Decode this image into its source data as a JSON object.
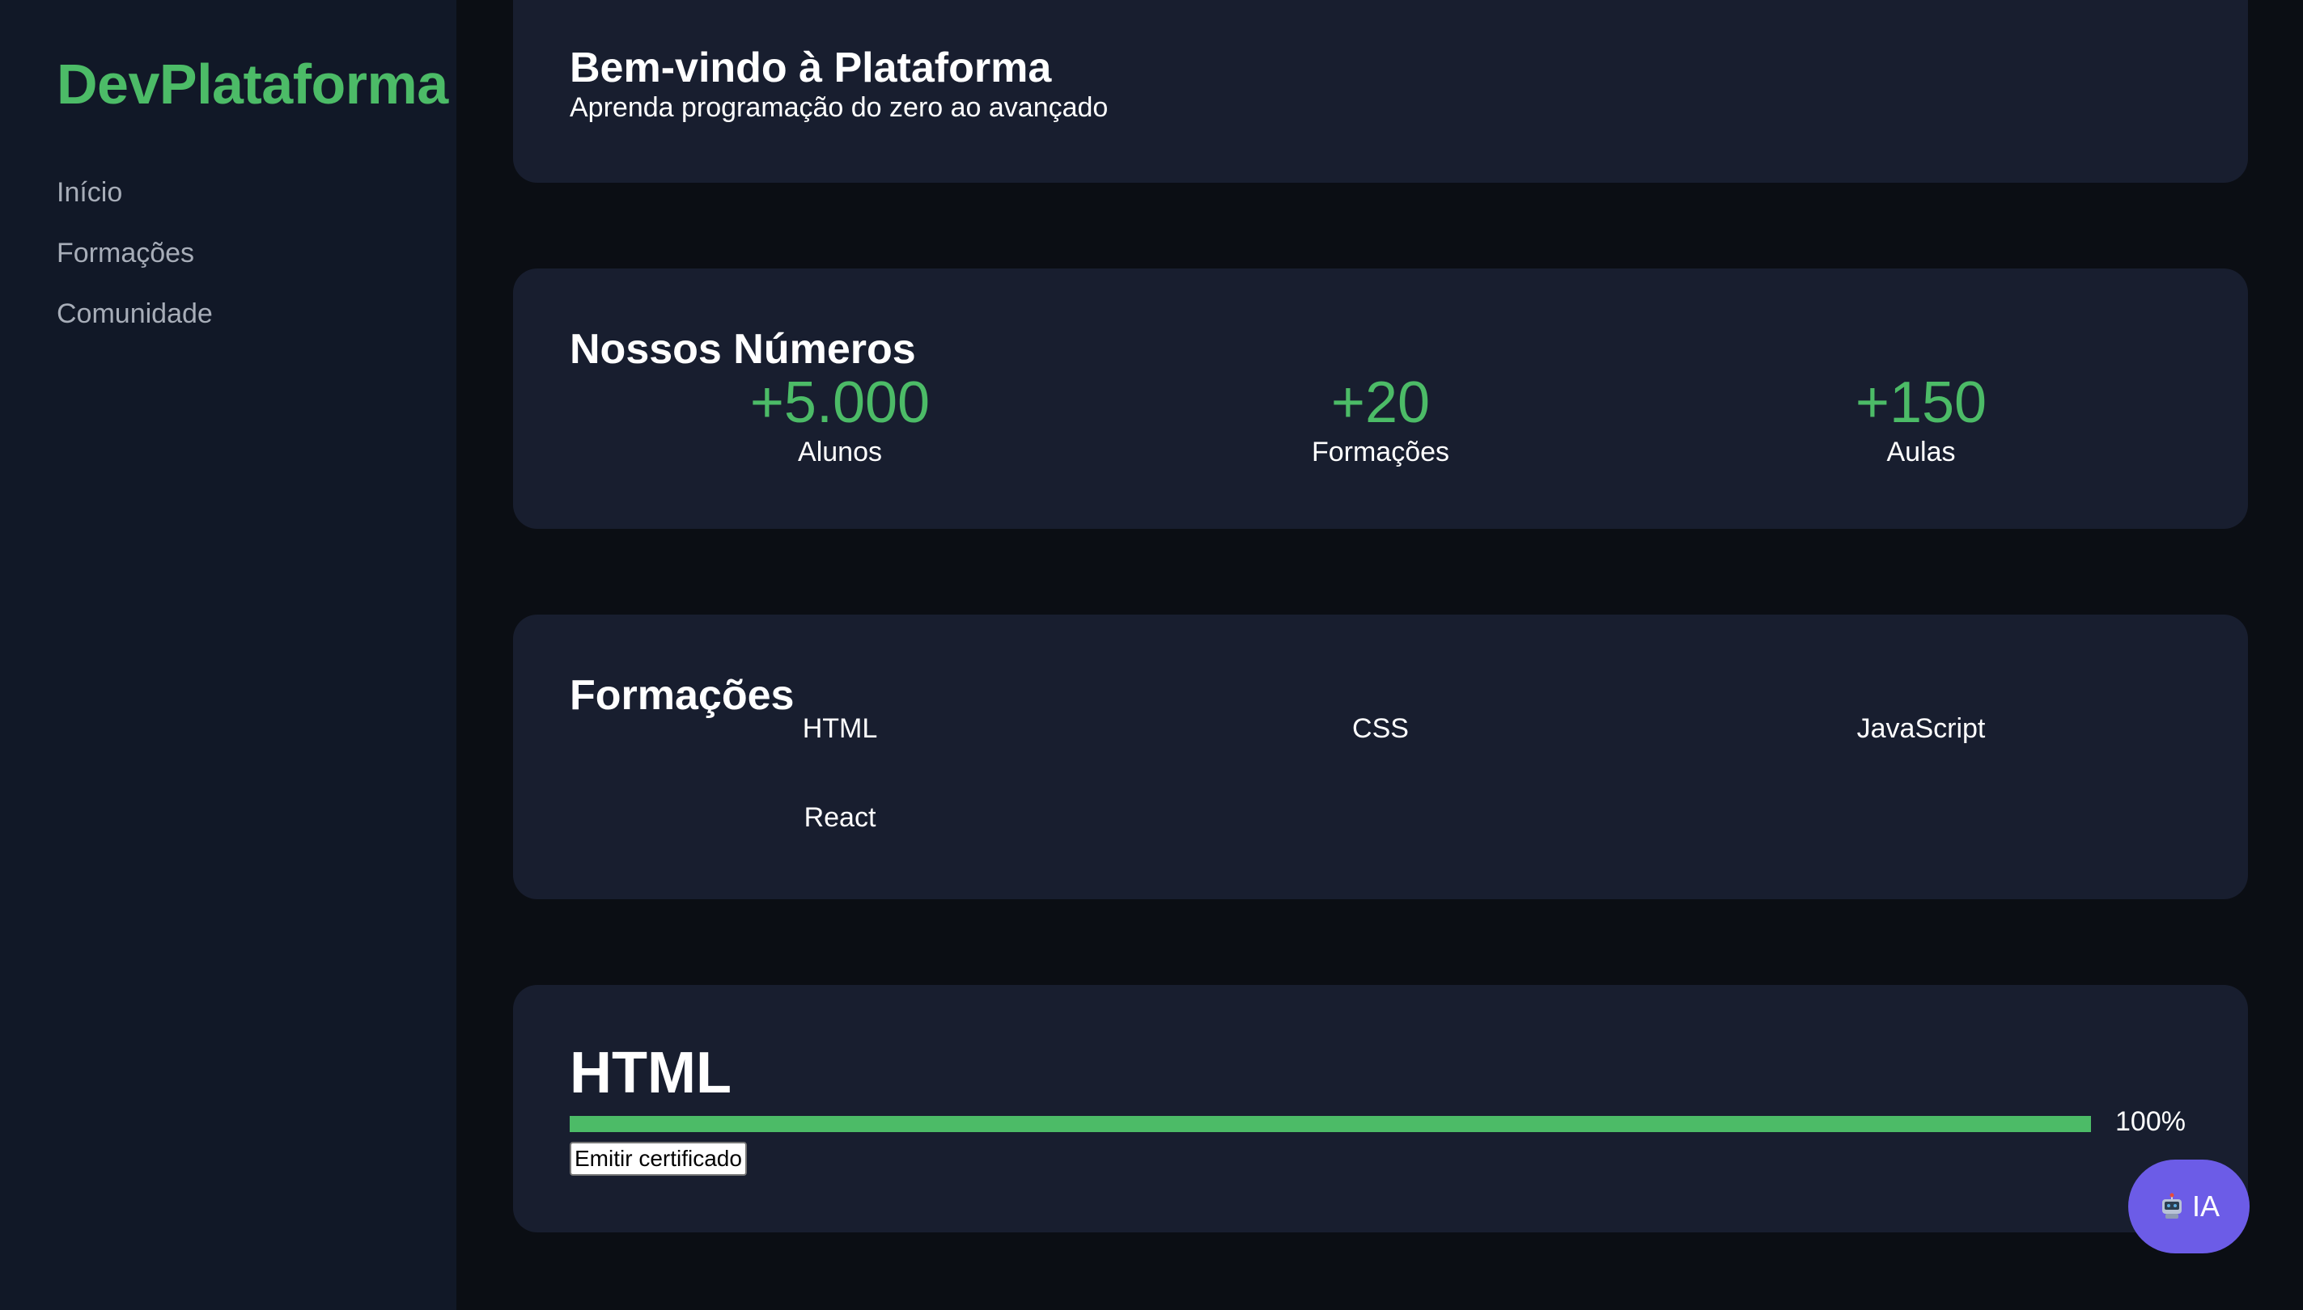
{
  "sidebar": {
    "brand": "DevPlataforma",
    "items": [
      {
        "label": "Início"
      },
      {
        "label": "Formações"
      },
      {
        "label": "Comunidade"
      }
    ]
  },
  "welcome": {
    "title": "Bem-vindo à Plataforma",
    "subtitle": "Aprenda programação do zero ao avançado"
  },
  "numbers": {
    "title": "Nossos Números",
    "stats": [
      {
        "value": "+5.000",
        "label": "Alunos"
      },
      {
        "value": "+20",
        "label": "Formações"
      },
      {
        "value": "+150",
        "label": "Aulas"
      }
    ]
  },
  "courses": {
    "title": "Formações",
    "items": [
      {
        "label": "HTML"
      },
      {
        "label": "CSS"
      },
      {
        "label": "JavaScript"
      },
      {
        "label": "React"
      }
    ]
  },
  "progress": {
    "title": "HTML",
    "percent": 100,
    "percent_label": "100%",
    "button_label": "Emitir certificado"
  },
  "assistant": {
    "label": "IA",
    "icon": "robot-icon"
  },
  "colors": {
    "accent": "#4cbb67",
    "card": "#181e2f",
    "sidebar": "#111827",
    "assistant": "#6c5ce7"
  }
}
